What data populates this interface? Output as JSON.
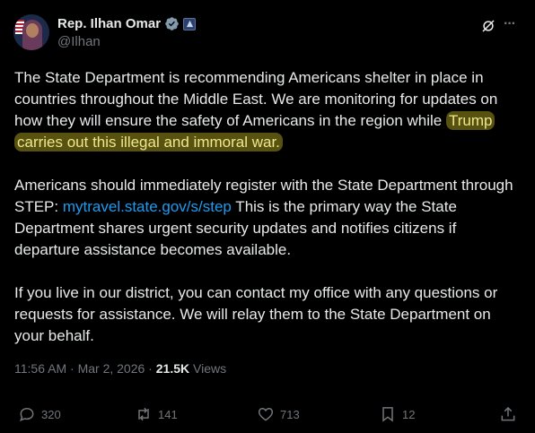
{
  "author": {
    "name": "Rep. Ilhan Omar",
    "handle": "@Ilhan"
  },
  "icons": {
    "verified": "verified-badge-icon",
    "government": "government-badge-icon",
    "grok": "grok-icon",
    "more": "more-icon"
  },
  "post": {
    "p1_text": "The State Department is recommending Americans shelter in place in countries throughout the Middle East. We are monitoring for updates on how they will ensure the safety of Americans in the region while ",
    "p1_highlight": "Trump carries out this illegal and immoral war.",
    "p2_before": "Americans should immediately register with the State Department through STEP: ",
    "p2_link": "mytravel.state.gov/s/step",
    "p2_after": " This is the primary way the State Department shares urgent security updates and notifies citizens if departure assistance becomes available.",
    "p3_text": "If you live in our district, you can contact my office with any questions or requests for assistance. We will relay them to the State Department on your behalf."
  },
  "meta": {
    "time": "11:56 AM",
    "sep1": " · ",
    "date": "Mar 2, 2026",
    "sep2": " · ",
    "views_count": "21.5K",
    "views_label": " Views"
  },
  "actions": {
    "replies": "320",
    "reposts": "141",
    "likes": "713",
    "bookmarks": "12"
  },
  "colors": {
    "background": "#000000",
    "text": "#e7e9ea",
    "muted": "#71767b",
    "link": "#1d9bf0",
    "highlight_bg": "#57520f",
    "verified": "#829aab"
  }
}
